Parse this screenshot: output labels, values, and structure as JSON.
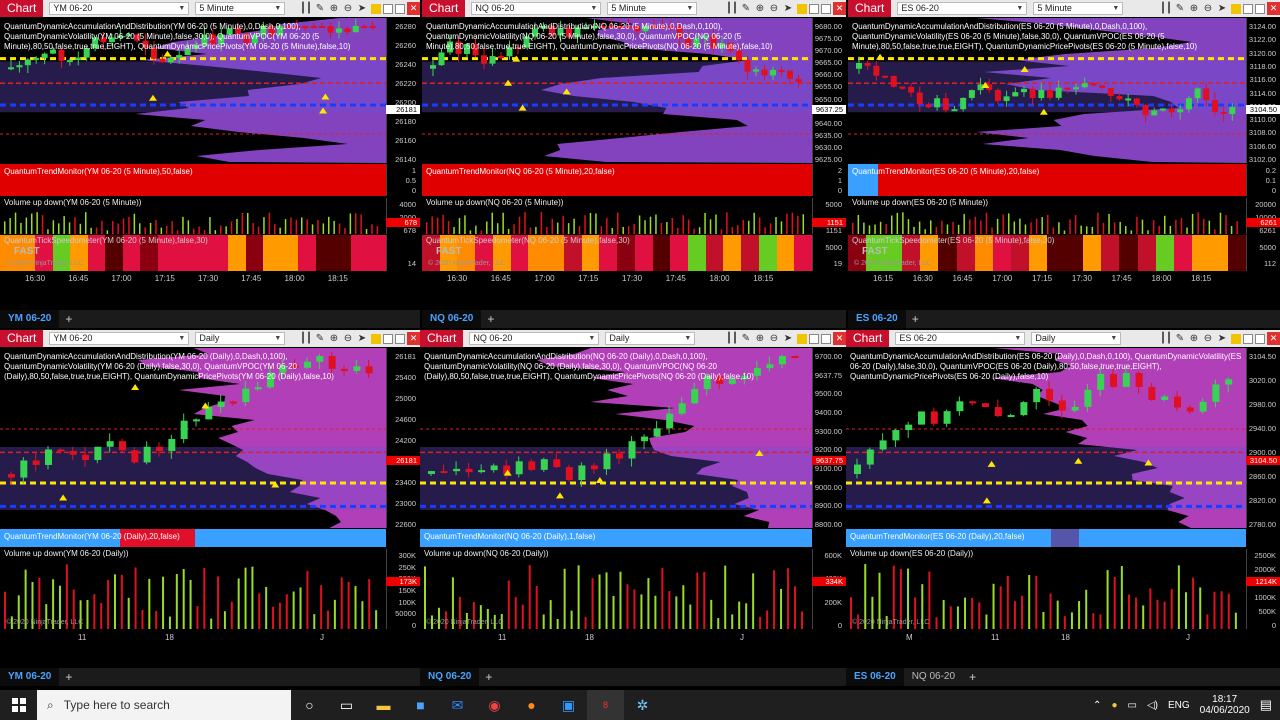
{
  "ui": {
    "chart_label": "Chart",
    "close": "✕",
    "tab_plus": "+",
    "period_5m": "5 Minute",
    "period_daily": "Daily",
    "fast": "FAST"
  },
  "charts": [
    {
      "instrument": "YM 06-20",
      "period": "5 Minute",
      "tab": "YM 06-20",
      "indicators": "QuantumDynamicAccumulationAndDistribution(YM 06-20 (5 Minute),0,Dash,0,100),\nQuantumDynamicVolatility(YM 06-20 (5 Minute),false,30,0), QuantumVPOC(YM 06-20 (5\nMinute),80,50,false,true,true,EIGHT), QuantumDynamicPricePivots(YM 06-20 (5 Minute),false,10)",
      "trend": "QuantumTrendMonitor(YM 06-20 (5 Minute),50,false)",
      "volume": "Volume up down(YM 06-20 (5 Minute))",
      "speedo": "QuantumTickSpeedometer(YM 06-20 (5 Minute),false,30)",
      "copyright": "© 2020 NinjaTrader, LLC",
      "price_ticks": [
        "26280",
        "26260",
        "26240",
        "26220",
        "26200",
        "26180",
        "26160",
        "26140"
      ],
      "price_last": "26181",
      "trend_ticks": [
        "1",
        "0.5",
        "0"
      ],
      "vol_ticks": [
        "4000",
        "2000",
        "678"
      ],
      "vol_last": "678",
      "speed_ticks": [
        "14"
      ],
      "time_ticks": [
        "16:30",
        "16:45",
        "17:00",
        "17:15",
        "17:30",
        "17:45",
        "18:00",
        "18:15"
      ]
    },
    {
      "instrument": "NQ 06-20",
      "period": "5 Minute",
      "tab": "NQ 06-20",
      "indicators": "QuantumDynamicAccumulationAndDistribution(NQ 06-20 (5 Minute),0,Dash,0,100),\nQuantumDynamicVolatility(NQ 06-20 (5 Minute),false,30,0), QuantumVPOC(NQ 06-20 (5\nMinute),80,50,false,true,true,EIGHT), QuantumDynamicPricePivots(NQ 06-20 (5 Minute),false,10)",
      "trend": "QuantumTrendMonitor(NQ 06-20 (5 Minute),20,false)",
      "volume": "Volume up down(NQ 06-20 (5 Minute))",
      "speedo": "QuantumTickSpeedometer(NQ 06-20 (5 Minute),false,30)",
      "copyright": "© 2020 NinjaTrader, LLC",
      "price_ticks": [
        "9680.00",
        "9675.00",
        "9670.00",
        "9665.00",
        "9660.00",
        "9655.00",
        "9650.00",
        "9645.00",
        "9640.00",
        "9635.00",
        "9630.00",
        "9625.00"
      ],
      "price_last": "9637.25",
      "trend_ticks": [
        "2",
        "1",
        "0"
      ],
      "vol_ticks": [
        "5000",
        "1151"
      ],
      "vol_last": "1151",
      "speed_ticks": [
        "5000",
        "19"
      ],
      "time_ticks": [
        "16:30",
        "16:45",
        "17:00",
        "17:15",
        "17:30",
        "17:45",
        "18:00",
        "18:15"
      ]
    },
    {
      "instrument": "ES 06-20",
      "period": "5 Minute",
      "tab": "ES 06-20",
      "indicators": "QuantumDynamicAccumulationAndDistribution(ES 06-20 (5 Minute),0,Dash,0,100),\nQuantumDynamicVolatility(ES 06-20 (5 Minute),false,30,0), QuantumVPOC(ES 06-20 (5\nMinute),80,50,false,true,true,EIGHT), QuantumDynamicPricePivots(ES 06-20 (5 Minute),false,10)",
      "trend": "QuantumTrendMonitor(ES 06-20 (5 Minute),20,false)",
      "volume": "Volume up down(ES 06-20 (5 Minute))",
      "speedo": "QuantumTickSpeedometer(ES 06-20 (5 Minute),false,30)",
      "copyright": "© 2020 NinjaTrader, LLC",
      "price_ticks": [
        "3124.00",
        "3122.00",
        "3120.00",
        "3118.00",
        "3116.00",
        "3114.00",
        "3112.00",
        "3110.00",
        "3108.00",
        "3106.00",
        "3102.00"
      ],
      "price_last": "3104.50",
      "trend_ticks": [
        "0.2",
        "0.1",
        "0"
      ],
      "vol_ticks": [
        "20000",
        "10000",
        "6261"
      ],
      "vol_last": "6261",
      "speed_ticks": [
        "5000",
        "112"
      ],
      "time_ticks": [
        "16:15",
        "16:30",
        "16:45",
        "17:00",
        "17:15",
        "17:30",
        "17:45",
        "18:00",
        "18:15"
      ]
    },
    {
      "instrument": "YM 06-20",
      "period": "Daily",
      "tab": "YM 06-20",
      "indicators": "QuantumDynamicAccumulationAndDistribution(YM 06-20 (Daily),0,Dash,0,100),\nQuantumDynamicVolatility(YM 06-20 (Daily),false,30,0), QuantumVPOC(YM 06-20\n(Daily),80,50,false,true,true,EIGHT), QuantumDynamicPricePivots(YM 06-20 (Daily),false,10)",
      "trend": "QuantumTrendMonitor(YM 06-20 (Daily),20,false)",
      "volume": "Volume up down(YM 06-20 (Daily))",
      "copyright": "© 2020 NinjaTrader, LLC",
      "price_ticks": [
        "26181",
        "25400",
        "25000",
        "24600",
        "24200",
        "23800",
        "23400",
        "23000",
        "22600"
      ],
      "price_last": "26181",
      "vol_ticks": [
        "300K",
        "250K",
        "200K",
        "150K",
        "100K",
        "50000",
        "0"
      ],
      "vol_last": "173K",
      "time_ticks": [
        "11",
        "18",
        "J"
      ]
    },
    {
      "instrument": "NQ 06-20",
      "period": "Daily",
      "tab": "NQ 06-20",
      "indicators": "QuantumDynamicAccumulationAndDistribution(NQ 06-20 (Daily),0,Dash,0,100),\nQuantumDynamicVolatility(NQ 06-20 (Daily),false,30,0), QuantumVPOC(NQ 06-20\n(Daily),80,50,false,true,true,EIGHT), QuantumDynamicPricePivots(NQ 06-20 (Daily),false,10)",
      "trend": "QuantumTrendMonitor(NQ 06-20 (Daily),1,false)",
      "volume": "Volume up down(NQ 06-20 (Daily))",
      "copyright": "© 2020 NinjaTrader, LLC",
      "price_ticks": [
        "9700.00",
        "9637.75",
        "9500.00",
        "9400.00",
        "9300.00",
        "9200.00",
        "9100.00",
        "9000.00",
        "8900.00",
        "8800.00"
      ],
      "price_last": "9637.75",
      "vol_ticks": [
        "600K",
        "400K",
        "200K",
        "0"
      ],
      "vol_last": "334K",
      "time_ticks": [
        "11",
        "18",
        "J"
      ]
    },
    {
      "instrument": "ES 06-20",
      "period": "Daily",
      "tab": "ES 06-20",
      "tab2": "NQ 06-20",
      "indicators": "QuantumDynamicAccumulationAndDistribution(ES 06-20 (Daily),0,Dash,0,100), QuantumDynamicVolatility(ES\n06-20 (Daily),false,30,0), QuantumVPOC(ES 06-20 (Daily),80,50,false,true,true,EIGHT),\nQuantumDynamicPricePivots(ES 06-20 (Daily),false,10)",
      "trend": "QuantumTrendMonitor(ES 06-20 (Daily),20,false)",
      "volume": "Volume up down(ES 06-20 (Daily))",
      "copyright": "© 2020 NinjaTrader, LLC",
      "price_ticks": [
        "3104.50",
        "3020.00",
        "2980.00",
        "2940.00",
        "2900.00",
        "2860.00",
        "2820.00",
        "2780.00"
      ],
      "price_last": "3104.50",
      "vol_ticks": [
        "2500K",
        "2000K",
        "1500K",
        "1000K",
        "500K",
        "0"
      ],
      "vol_last": "1214K",
      "time_ticks": [
        "M",
        "11",
        "18",
        "J"
      ]
    }
  ],
  "taskbar": {
    "search_placeholder": "Type here to search",
    "lang": "ENG",
    "time": "18:17",
    "date": "04/06/2020",
    "badge": "8"
  }
}
